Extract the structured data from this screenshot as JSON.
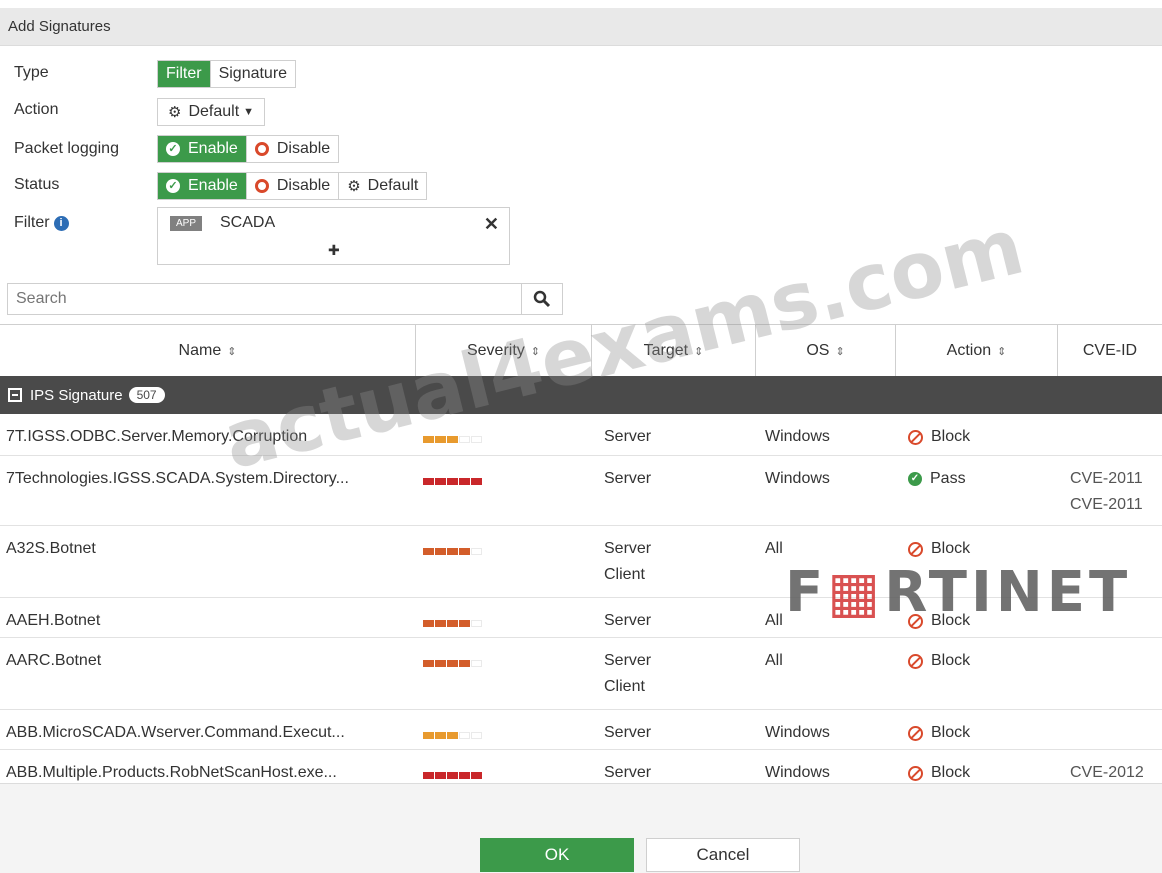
{
  "dialog": {
    "title": "Add Signatures"
  },
  "form": {
    "type_label": "Type",
    "type_options": [
      "Filter",
      "Signature"
    ],
    "action_label": "Action",
    "action_value": "Default",
    "packet_logging_label": "Packet logging",
    "packet_logging_options": [
      "Enable",
      "Disable"
    ],
    "status_label": "Status",
    "status_options": [
      "Enable",
      "Disable",
      "Default"
    ],
    "filter_label": "Filter",
    "filter_tag": "APP",
    "filter_value": "SCADA"
  },
  "search": {
    "placeholder": "Search"
  },
  "table": {
    "columns": [
      "Name",
      "Severity",
      "Target",
      "OS",
      "Action",
      "CVE-ID"
    ],
    "group": {
      "label": "IPS Signature",
      "count": "507"
    },
    "rows": [
      {
        "name": "7T.IGSS.ODBC.Server.Memory.Corruption",
        "severity": 3,
        "target1": "Server",
        "target2": "",
        "os": "Windows",
        "action": "Block",
        "cve1": "",
        "cve2": ""
      },
      {
        "name": "7Technologies.IGSS.SCADA.System.Directory...",
        "severity": 5,
        "target1": "Server",
        "target2": "",
        "os": "Windows",
        "action": "Pass",
        "cve1": "CVE-2011",
        "cve2": "CVE-2011"
      },
      {
        "name": "A32S.Botnet",
        "severity": 4,
        "target1": "Server",
        "target2": "Client",
        "os": "All",
        "action": "Block",
        "cve1": "",
        "cve2": ""
      },
      {
        "name": "AAEH.Botnet",
        "severity": 4,
        "target1": "Server",
        "target2": "",
        "os": "All",
        "action": "Block",
        "cve1": "",
        "cve2": ""
      },
      {
        "name": "AARC.Botnet",
        "severity": 4,
        "target1": "Server",
        "target2": "Client",
        "os": "All",
        "action": "Block",
        "cve1": "",
        "cve2": ""
      },
      {
        "name": "ABB.MicroSCADA.Wserver.Command.Execut...",
        "severity": 3,
        "target1": "Server",
        "target2": "",
        "os": "Windows",
        "action": "Block",
        "cve1": "",
        "cve2": ""
      },
      {
        "name": "ABB.Multiple.Products.RobNetScanHost.exe...",
        "severity": 5,
        "target1": "Server",
        "target2": "",
        "os": "Windows",
        "action": "Block",
        "cve1": "CVE-2012",
        "cve2": ""
      }
    ]
  },
  "buttons": {
    "ok": "OK",
    "cancel": "Cancel"
  },
  "watermark": "actual4exams.com",
  "logo": "FORTINET",
  "colors": {
    "accent_green": "#3c9a4a",
    "block_red": "#d9492b",
    "group_dark": "#4a4a4a"
  }
}
